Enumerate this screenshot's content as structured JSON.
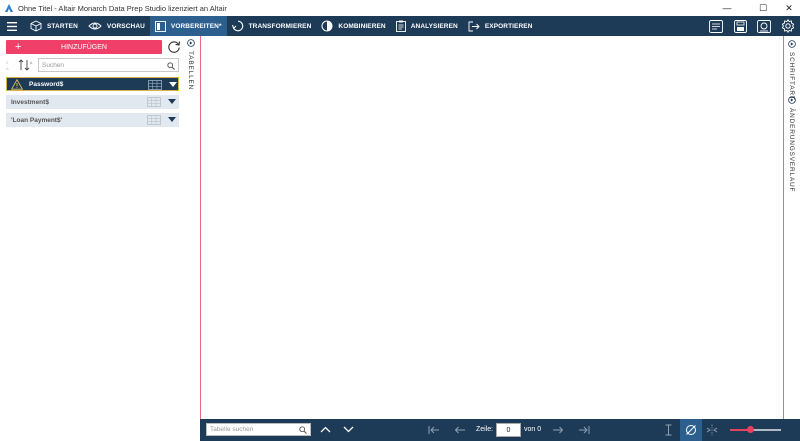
{
  "window": {
    "title": "Ohne Titel - Altair Monarch Data Prep Studio lizenziert an Altair",
    "controls": {
      "minimize": "—",
      "maximize": "☐",
      "close": "✕"
    }
  },
  "toolbar": {
    "menu_icon": "hamburger-icon",
    "items": [
      {
        "label": "STARTEN",
        "icon": "cube-icon"
      },
      {
        "label": "VORSCHAU",
        "icon": "eye-icon"
      },
      {
        "label": "VORBEREITEN*",
        "icon": "panel-icon",
        "active": true
      },
      {
        "label": "TRANSFORMIEREN",
        "icon": "cycle-icon"
      },
      {
        "label": "KOMBINIEREN",
        "icon": "combine-icon"
      },
      {
        "label": "ANALYSIEREN",
        "icon": "clipboard-icon"
      },
      {
        "label": "EXPORTIEREN",
        "icon": "export-icon"
      }
    ],
    "right_icons": [
      "report-icon",
      "save-icon",
      "workspace-icon",
      "gear-icon"
    ],
    "colors": {
      "bar": "#1d3a57",
      "active": "#2d5f8e"
    }
  },
  "left_panel": {
    "add_button": {
      "label": "HINZUFÜGEN",
      "plus": "+"
    },
    "search": {
      "placeholder": "Suchen",
      "value": ""
    },
    "tables": [
      {
        "name": "Password$",
        "warning": true,
        "selected": true
      },
      {
        "name": "Investment$",
        "warning": false,
        "selected": false
      },
      {
        "name": "'Loan Payment$'",
        "warning": false,
        "selected": false
      }
    ],
    "vertical_tab": "TABELLEN",
    "colors": {
      "add_button": "#f0406a",
      "row": "#e2e8ef",
      "selected_border": "#d8b34a"
    }
  },
  "right_panel": {
    "tabs": [
      "SCHRIFTART",
      "ÄNDERUNGSVERLAUF"
    ]
  },
  "bottom_bar": {
    "search": {
      "placeholder": "Tabelle suchen",
      "value": ""
    },
    "row_label": "Zeile:",
    "row_value": "0",
    "of_label": "von 0",
    "zoom_fraction": 0.4,
    "colors": {
      "slider": "#e8405e"
    }
  }
}
